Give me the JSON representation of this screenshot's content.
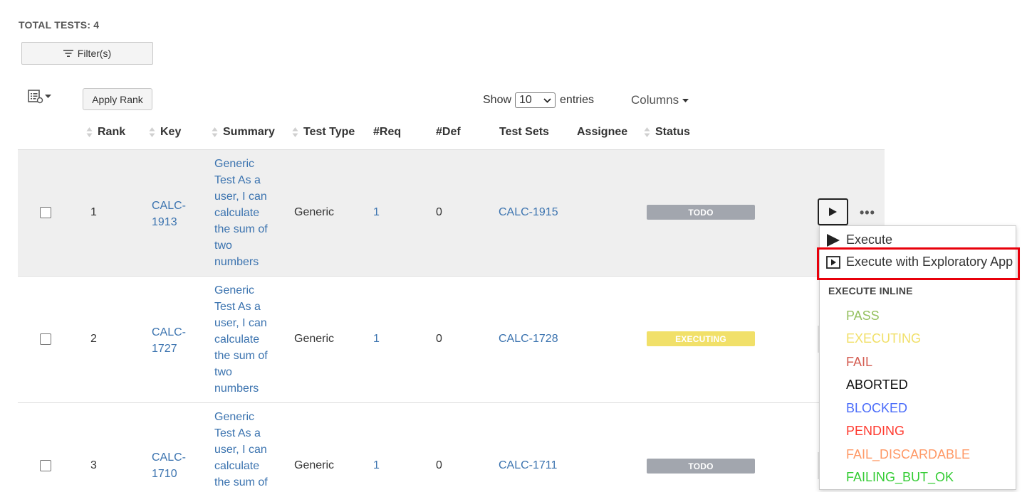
{
  "header": {
    "total_tests": "TOTAL TESTS: 4"
  },
  "toolbar": {
    "filter_label": "Filter(s)",
    "apply_rank_label": "Apply Rank",
    "show_label": "Show",
    "entries_value": "10",
    "entries_label": "entries",
    "columns_label": "Columns"
  },
  "table": {
    "columns": [
      "Rank",
      "Key",
      "Summary",
      "Test Type",
      "#Req",
      "#Def",
      "Test Sets",
      "Assignee",
      "Status"
    ],
    "rows": [
      {
        "rank": "1",
        "key_line1": "CALC-",
        "key_line2": "1913",
        "summary_lines": [
          "Generic",
          "Test As a",
          "user, I can",
          "calculate",
          "the sum of",
          "two",
          "numbers"
        ],
        "test_type": "Generic",
        "req": "1",
        "def": "0",
        "test_set": "CALC-1915",
        "assignee": "",
        "status": "TODO"
      },
      {
        "rank": "2",
        "key_line1": "CALC-",
        "key_line2": "1727",
        "summary_lines": [
          "Generic",
          "Test As a",
          "user, I can",
          "calculate",
          "the sum of",
          "two",
          "numbers"
        ],
        "test_type": "Generic",
        "req": "1",
        "def": "0",
        "test_set": "CALC-1728",
        "assignee": "",
        "status": "EXECUTING"
      },
      {
        "rank": "3",
        "key_line1": "CALC-",
        "key_line2": "1710",
        "summary_lines": [
          "Generic",
          "Test As a",
          "user, I can",
          "calculate",
          "the sum of"
        ],
        "test_type": "Generic",
        "req": "1",
        "def": "0",
        "test_set": "CALC-1711",
        "assignee": "",
        "status": "TODO"
      }
    ]
  },
  "execute_menu": {
    "execute_label": "Execute",
    "exploratory_label": "Execute with Exploratory App",
    "inline_heading": "EXECUTE INLINE",
    "statuses": [
      {
        "label": "PASS",
        "color": "#95c160"
      },
      {
        "label": "EXECUTING",
        "color": "#f1e069"
      },
      {
        "label": "FAIL",
        "color": "#d45d52"
      },
      {
        "label": "ABORTED",
        "color": "#111111"
      },
      {
        "label": "BLOCKED",
        "color": "#4a6cfa"
      },
      {
        "label": "PENDING",
        "color": "#ff3b30"
      },
      {
        "label": "FAIL_DISCARDABLE",
        "color": "#ff9966"
      },
      {
        "label": "FAILING_BUT_OK",
        "color": "#33cc33"
      }
    ]
  },
  "colors": {
    "todo": "#a2a6ae",
    "executing": "#f1e069",
    "link": "#3b73af",
    "highlight": "#e8000b",
    "selected_row": "#efefef"
  }
}
